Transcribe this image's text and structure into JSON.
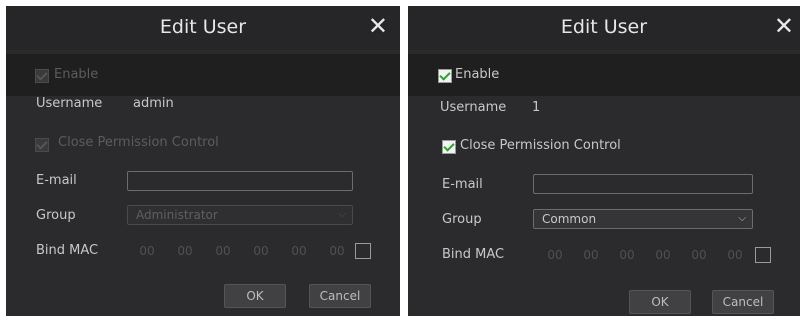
{
  "dialogs": [
    {
      "title": "Edit User",
      "close_glyph": "✕",
      "enable": {
        "label": "Enable",
        "checked": true,
        "disabled": true
      },
      "username": {
        "label": "Username",
        "value": "admin"
      },
      "close_permission": {
        "label": "Close Permission Control",
        "checked": true,
        "disabled": true
      },
      "email": {
        "label": "E-mail",
        "value": ""
      },
      "group": {
        "label": "Group",
        "value": "Administrator",
        "disabled": true
      },
      "bind_mac": {
        "label": "Bind MAC",
        "segments": [
          "00",
          "00",
          "00",
          "00",
          "00",
          "00"
        ],
        "checked": false
      },
      "ok_label": "OK",
      "cancel_label": "Cancel"
    },
    {
      "title": "Edit User",
      "close_glyph": "✕",
      "enable": {
        "label": "Enable",
        "checked": true,
        "disabled": false
      },
      "username": {
        "label": "Username",
        "value": "1"
      },
      "close_permission": {
        "label": "Close Permission Control",
        "checked": true,
        "disabled": false
      },
      "email": {
        "label": "E-mail",
        "value": ""
      },
      "group": {
        "label": "Group",
        "value": "Common",
        "disabled": false
      },
      "bind_mac": {
        "label": "Bind MAC",
        "segments": [
          "00",
          "00",
          "00",
          "00",
          "00",
          "00"
        ],
        "checked": false
      },
      "ok_label": "OK",
      "cancel_label": "Cancel"
    }
  ],
  "colors": {
    "dialog_bg": "#2b2b2d",
    "check_green": "#2aa52a",
    "text": "#c8c8c8",
    "disabled_text": "#5c5c5c"
  },
  "icons": {
    "close": "close-icon",
    "dropdown": "chevron-down-icon",
    "check": "check-icon"
  }
}
